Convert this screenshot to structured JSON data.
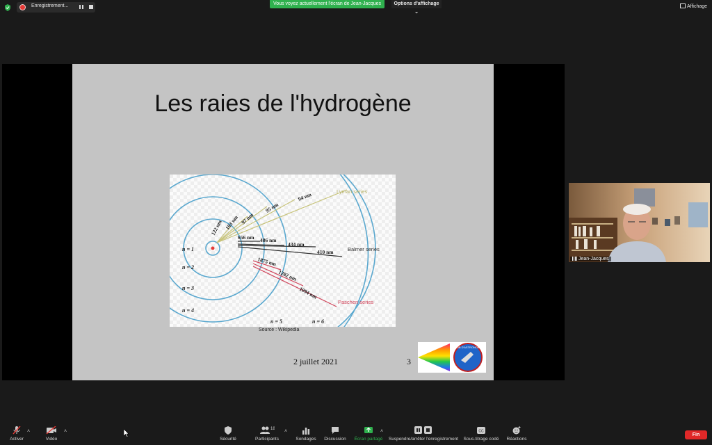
{
  "top_bar": {
    "recording_label": "Enregistrement...",
    "share_banner": "Vous voyez actuellement l'écran de Jean-Jacques",
    "view_options": "Options d'affichage",
    "view_button": "Affichage"
  },
  "slide": {
    "title": "Les raies de l'hydrogène",
    "diagram": {
      "levels": [
        "n = 1",
        "n = 2",
        "n = 3",
        "n = 4",
        "n = 5",
        "n = 6"
      ],
      "lyman": [
        "122 nm",
        "103 nm",
        "97 nm",
        "95 nm",
        "94 nm"
      ],
      "lyman_label": "Lyman series",
      "balmer": [
        "656 nm",
        "486 nm",
        "434 nm",
        "410 nm"
      ],
      "balmer_label": "Balmer series",
      "paschen": [
        "1875 nm",
        "1282 nm",
        "1094 nm"
      ],
      "paschen_label": "Paschen series"
    },
    "source": "Source : Wikipedia",
    "date": "2 juillet 2021",
    "page_number": "3",
    "logo_text": "CLUB D'ASTRONOMIE"
  },
  "participant": {
    "name": "Jean-Jacques"
  },
  "toolbar": {
    "mute": "Activer",
    "video": "Vidéo",
    "security": "Sécurité",
    "participants": "Participants",
    "participants_count": "18",
    "polls": "Sondages",
    "chat": "Discussion",
    "share": "Écran partagé",
    "record": "Suspendre/arrêter l'enregistrement",
    "captions": "Sous-titrage codé",
    "reactions": "Réactions",
    "end": "Fin"
  },
  "colors": {
    "share_green": "#2fb14e",
    "end_red": "#e02828",
    "lyman": "#c7c37a",
    "balmer": "#333333",
    "paschen": "#d0445a",
    "orbit": "#5aa8cf"
  }
}
